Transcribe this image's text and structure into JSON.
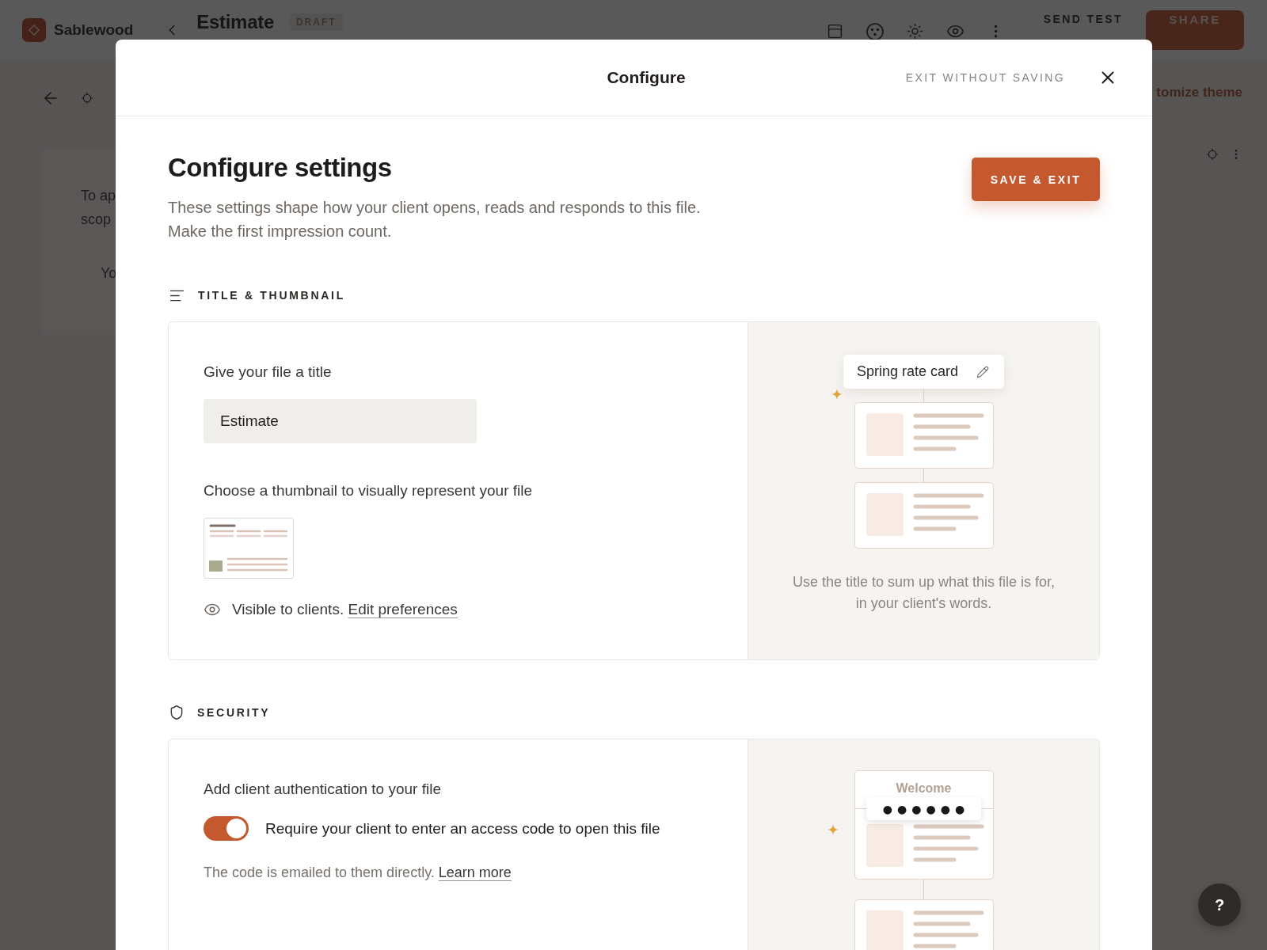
{
  "app_bar": {
    "brand": "Sablewood",
    "title": "Estimate",
    "badge": "DRAFT",
    "send_test": "SEND TEST",
    "share": "SHARE"
  },
  "background": {
    "paragraph_lines": [
      "To ap",
      "scop"
    ],
    "quote": "Yo",
    "theme_link": "tomize theme"
  },
  "modal": {
    "title": "Configure",
    "exit_button": "EXIT WITHOUT SAVING",
    "heading": "Configure settings",
    "description": "These settings shape how your client opens, reads and responds to this file. Make the first impression count.",
    "save_button": "SAVE & EXIT",
    "sections": [
      {
        "kind": "title",
        "heading": "TITLE & THUMBNAIL",
        "title_label": "Give your file a title",
        "title_value": "Estimate",
        "thumbnail_label": "Choose a thumbnail to visually represent your file",
        "visibility_text": "Visible to clients.",
        "visibility_link": "Edit preferences",
        "preview_title": "Spring rate card",
        "caption": "Use the title to sum up what this file is for, in your client's words."
      },
      {
        "kind": "security",
        "heading": "SECURITY",
        "auth_label": "Add client authentication to your file",
        "access_code_required": true,
        "toggle_label": "Require your client to enter an access code to open this file",
        "note": "The code is emailed to them directly.",
        "note_link": "Learn more",
        "preview_greeting": "Welcome",
        "preview_code": "●●●●●●"
      }
    ]
  },
  "help_button": "?"
}
